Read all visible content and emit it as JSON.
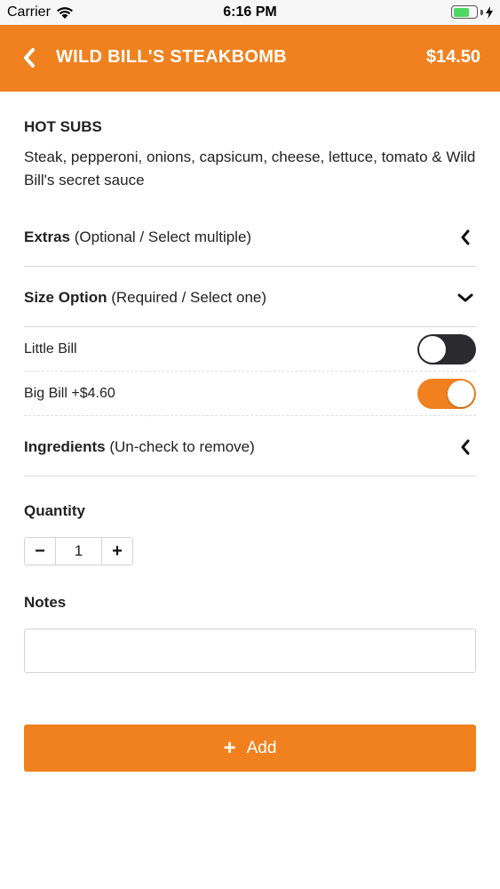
{
  "status_bar": {
    "carrier": "Carrier",
    "time": "6:16 PM",
    "wifi_icon": "wifi-icon",
    "battery_icon": "battery-icon",
    "charging_icon": "bolt-icon"
  },
  "header": {
    "back_icon": "chevron-left-icon",
    "title": "WILD BILL'S STEAKBOMB",
    "price": "$14.50",
    "background": "#f0811e"
  },
  "product": {
    "category": "HOT SUBS",
    "description": "Steak, pepperoni, onions, capsicum, cheese, lettuce, tomato & Wild Bill's secret sauce"
  },
  "sections": {
    "extras": {
      "title": "Extras",
      "hint": "(Optional / Select multiple)",
      "expanded": false
    },
    "size": {
      "title": "Size Option",
      "hint": "(Required / Select one)",
      "expanded": true,
      "options": [
        {
          "label": "Little Bill",
          "selected": false
        },
        {
          "label": "Big Bill +$4.60",
          "selected": true
        }
      ]
    },
    "ingredients": {
      "title": "Ingredients",
      "hint": "(Un-check to remove)",
      "expanded": false
    }
  },
  "quantity": {
    "label": "Quantity",
    "value": "1",
    "minus": "−",
    "plus": "+"
  },
  "notes": {
    "label": "Notes",
    "value": "",
    "placeholder": ""
  },
  "add_button": {
    "icon": "plus-icon",
    "label": "Add"
  },
  "colors": {
    "accent": "#f0811e",
    "toggle_off": "#2b2b2f",
    "divider": "#d9d9d9"
  }
}
